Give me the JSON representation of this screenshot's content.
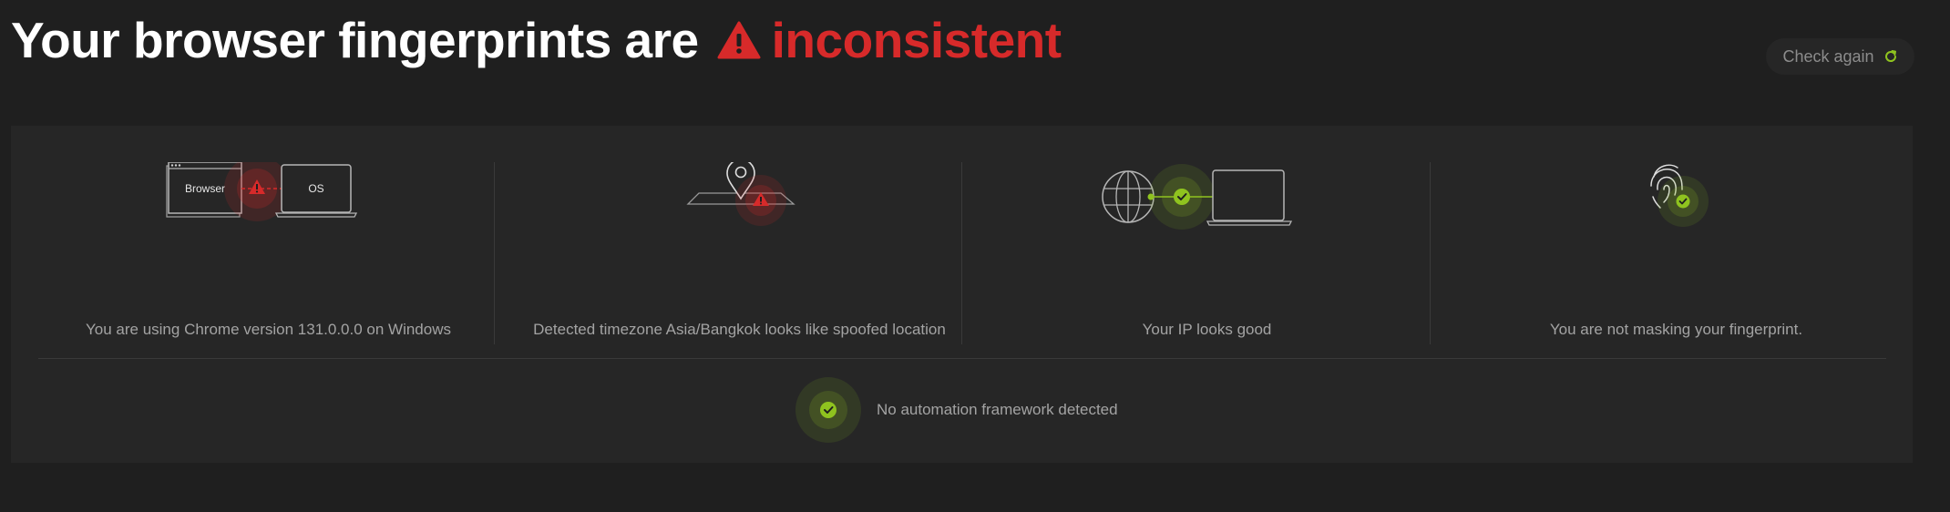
{
  "header": {
    "title_prefix": "Your browser fingerprints are",
    "status_word": "inconsistent",
    "status_icon": "warning-triangle-icon",
    "status_color": "#d72a2a"
  },
  "check_again": {
    "label": "Check again",
    "icon": "refresh-icon",
    "icon_color": "#8fc31f"
  },
  "cards": [
    {
      "id": "browser-os",
      "status": "warning",
      "browser_label": "Browser",
      "os_label": "OS",
      "text": "You are using Chrome version 131.0.0.0 on Windows"
    },
    {
      "id": "timezone",
      "status": "warning",
      "text": "Detected timezone Asia/Bangkok looks like spoofed location"
    },
    {
      "id": "ip",
      "status": "ok",
      "text": "Your IP looks good"
    },
    {
      "id": "fingerprint",
      "status": "ok",
      "text": "You are not masking your fingerprint."
    }
  ],
  "automation": {
    "status": "ok",
    "text": "No automation framework detected"
  },
  "colors": {
    "background": "#1f1f1f",
    "panel": "#262626",
    "warning": "#d72a2a",
    "ok": "#8fc31f",
    "muted_text": "#a3a3a3"
  }
}
